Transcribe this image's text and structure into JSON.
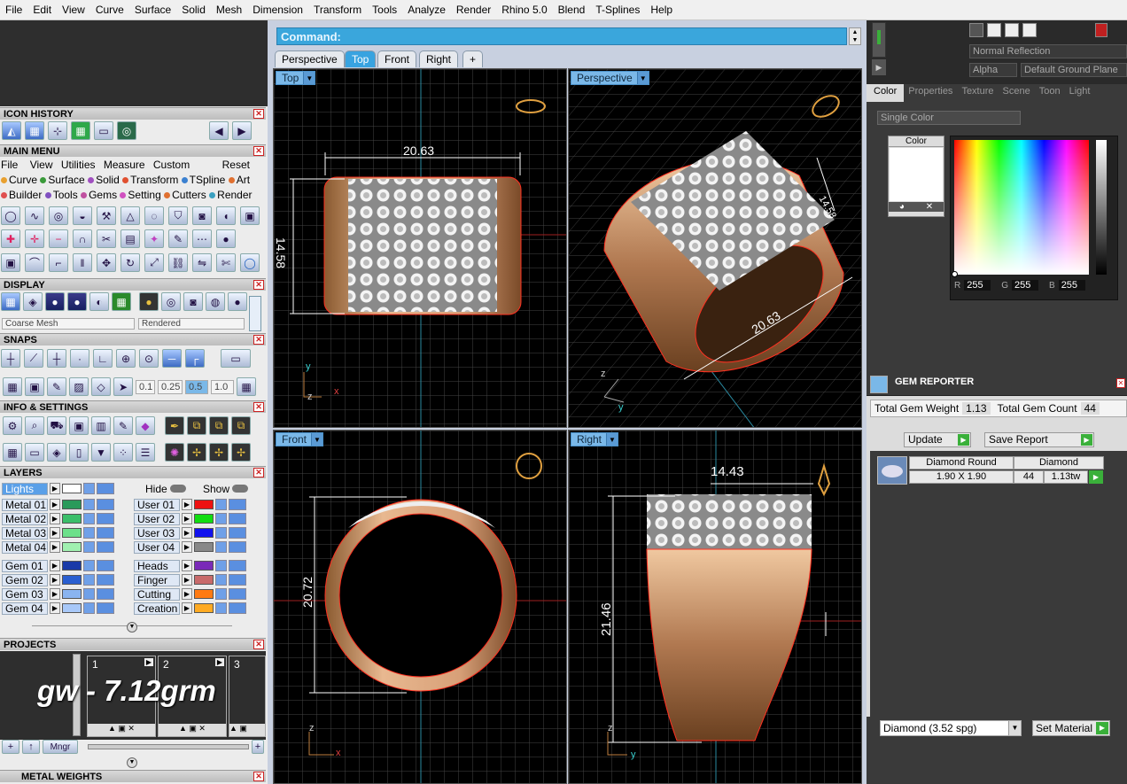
{
  "menubar": [
    "File",
    "Edit",
    "View",
    "Curve",
    "Surface",
    "Solid",
    "Mesh",
    "Dimension",
    "Transform",
    "Tools",
    "Analyze",
    "Render",
    "Rhino 5.0",
    "Blend",
    "T-Splines",
    "Help"
  ],
  "command": {
    "label": "Command:"
  },
  "viewport_tabs": [
    "Perspective",
    "Top",
    "Front",
    "Right",
    "+"
  ],
  "viewports": {
    "top": {
      "label": "Top",
      "dim_h": "20.63",
      "dim_v": "14.58",
      "axis_y": "y",
      "axis_z": "z",
      "axis_x": "x"
    },
    "perspective": {
      "label": "Perspective",
      "dim1": "20.63",
      "dim2": "14.58"
    },
    "front": {
      "label": "Front",
      "dim_v": "20.72",
      "axis_z": "z",
      "axis_x": "x"
    },
    "right": {
      "label": "Right",
      "dim_h": "14.43",
      "dim_v": "21.46",
      "axis_z": "z",
      "axis_y": "y"
    }
  },
  "left": {
    "icon_history": "ICON HISTORY",
    "main_menu": {
      "title": "MAIN MENU",
      "items": [
        "File",
        "View",
        "Utilities",
        "Measure",
        "Custom"
      ],
      "reset": "Reset",
      "cats1": [
        "Curve",
        "Surface",
        "Solid",
        "Transform",
        "TSpline",
        "Art"
      ],
      "cats2": [
        "Builder",
        "Tools",
        "Gems",
        "Setting",
        "Cutters",
        "Render"
      ]
    },
    "display": {
      "title": "DISPLAY",
      "mesh": "Coarse Mesh",
      "mode": "Rendered"
    },
    "snaps": {
      "title": "SNAPS",
      "values": [
        "0.1",
        "0.25",
        "0.5",
        "1.0"
      ]
    },
    "info": "INFO & SETTINGS",
    "layers": {
      "title": "LAYERS",
      "lights": "Lights",
      "hide": "Hide",
      "show": "Show",
      "col1": [
        {
          "name": "Metal 01",
          "color": "#2a9a5a"
        },
        {
          "name": "Metal 02",
          "color": "#3bbf6a"
        },
        {
          "name": "Metal 03",
          "color": "#6ce08a"
        },
        {
          "name": "Metal 04",
          "color": "#a0f0b0"
        },
        {
          "name": "Gem 01",
          "color": "#1a3aa8"
        },
        {
          "name": "Gem 02",
          "color": "#2a5fd0"
        },
        {
          "name": "Gem 03",
          "color": "#8ab4f0"
        },
        {
          "name": "Gem 04",
          "color": "#a8c8f8"
        }
      ],
      "col2": [
        {
          "name": "User 01",
          "color": "#ee1111"
        },
        {
          "name": "User 02",
          "color": "#11dd11"
        },
        {
          "name": "User 03",
          "color": "#1111ee"
        },
        {
          "name": "User 04",
          "color": "#888888"
        },
        {
          "name": "Heads",
          "color": "#7a2ab8"
        },
        {
          "name": "Finger",
          "color": "#c86a6a"
        },
        {
          "name": "Cutting",
          "color": "#ff7a11"
        },
        {
          "name": "Creation",
          "color": "#ffaa22"
        }
      ]
    },
    "projects": {
      "title": "PROJECTS",
      "slots": [
        "1",
        "2",
        "3"
      ],
      "overlay": "gw - 7.12grm",
      "mngr": "Mngr"
    },
    "metal_weights": "METAL WEIGHTS"
  },
  "right": {
    "reflection": "Normal Reflection",
    "alpha": "Alpha",
    "ground": "Default Ground Plane",
    "tabs": [
      "Color",
      "Properties",
      "Texture",
      "Scene",
      "Toon",
      "Light"
    ],
    "color_mode": "Single Color",
    "color_label": "Color",
    "rgb": {
      "r_label": "R",
      "r": "255",
      "g_label": "G",
      "g": "255",
      "b_label": "B",
      "b": "255"
    },
    "gem_reporter": {
      "title": "GEM REPORTER",
      "weight_label": "Total Gem Weight",
      "weight": "1.13",
      "count_label": "Total Gem Count",
      "count": "44",
      "update": "Update",
      "save": "Save Report",
      "row": {
        "shape": "Diamond Round",
        "material": "Diamond",
        "size": "1.90 X 1.90",
        "qty": "44",
        "tw": "1.13tw"
      },
      "material_select": "Diamond     (3.52 spg)",
      "set_material": "Set Material"
    }
  }
}
